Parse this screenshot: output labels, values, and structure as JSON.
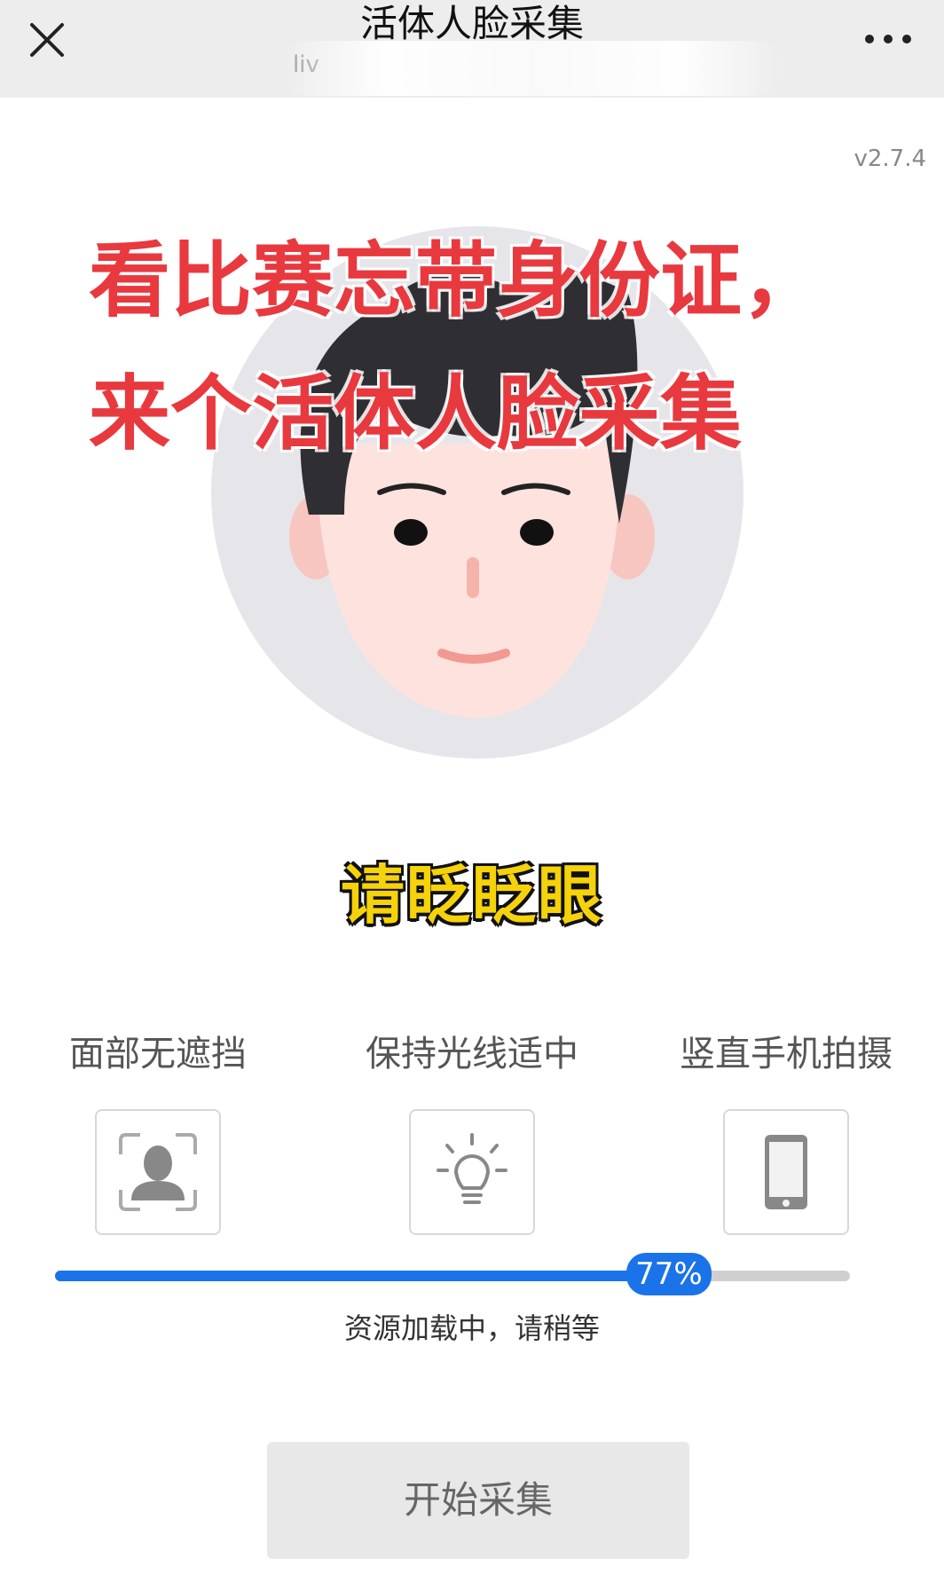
{
  "nav": {
    "title": "活体人脸采集",
    "subtitle": "liv"
  },
  "version": "v2.7.4",
  "overlay": {
    "line1": "看比赛忘带身份证，",
    "line2": "来个活体人脸采集"
  },
  "prompt": "请眨眨眼",
  "tips": [
    {
      "label": "面部无遮挡",
      "icon": "face-frame-icon"
    },
    {
      "label": "保持光线适中",
      "icon": "light-bulb-icon"
    },
    {
      "label": "竖直手机拍摄",
      "icon": "phone-icon"
    }
  ],
  "progress": {
    "percent": 77,
    "label": "77%",
    "status": "资源加载中，请稍等"
  },
  "start_button": "开始采集",
  "colors": {
    "accent": "#1a73e8",
    "overlay_text": "#e8393f",
    "prompt_text": "#f5d20a"
  }
}
